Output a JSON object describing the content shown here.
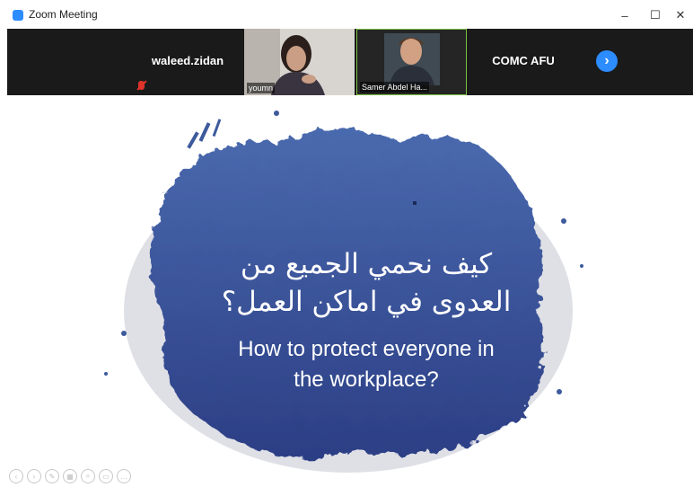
{
  "window": {
    "title": "Zoom Meeting",
    "controls": [
      "–",
      "☐",
      "✕"
    ]
  },
  "participants": [
    {
      "name": "waleed.zidan",
      "video": false,
      "muted": true
    },
    {
      "name": "youmn",
      "video": true
    },
    {
      "name": "Samer Abdel Ha...",
      "video": true,
      "active_speaker": true
    },
    {
      "name": "COMC AFU",
      "video": false
    }
  ],
  "strip": {
    "next_icon": "chevron-right-icon"
  },
  "slide": {
    "arabic_line1": "كيف نحمي الجميع من",
    "arabic_line2": "العدوى في اماكن العمل؟",
    "english_line1": "How to protect everyone in",
    "english_line2": "the workplace?",
    "colors": {
      "blob_top": "#4A6AAE",
      "blob_bottom": "#2C3E85"
    }
  },
  "presentation_toolbar": [
    "previous-icon",
    "next-icon",
    "pen-icon",
    "slides-icon",
    "zoom-icon",
    "screen-icon",
    "more-icon"
  ]
}
